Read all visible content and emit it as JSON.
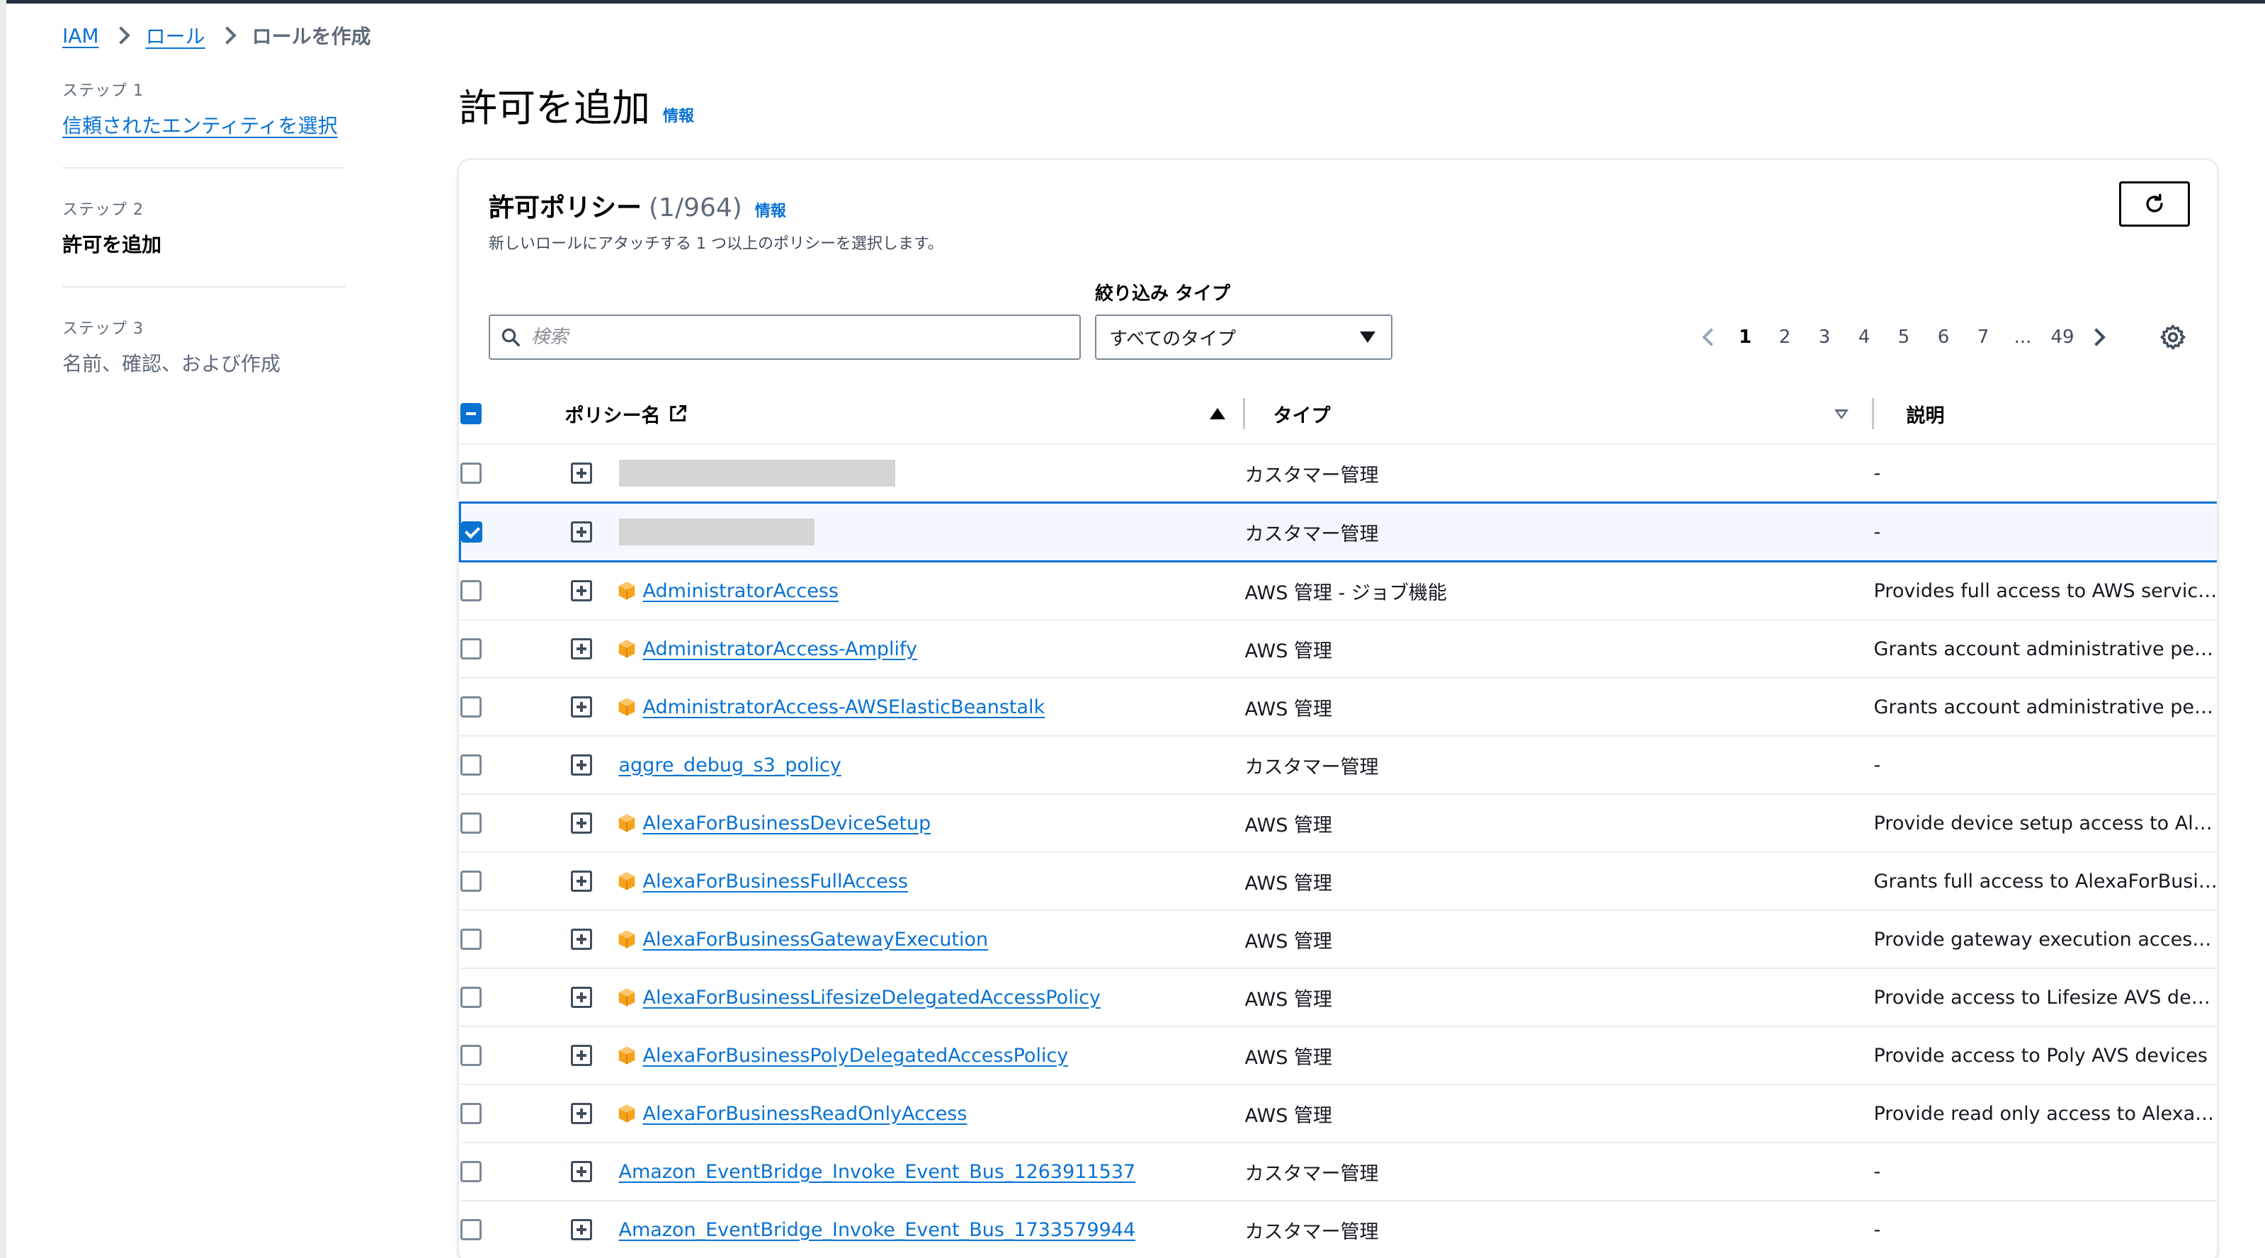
{
  "breadcrumb": {
    "iam": "IAM",
    "roles": "ロール",
    "current": "ロールを作成"
  },
  "steps": [
    {
      "label": "ステップ 1",
      "title": "信頼されたエンティティを選択"
    },
    {
      "label": "ステップ 2",
      "title": "許可を追加"
    },
    {
      "label": "ステップ 3",
      "title": "名前、確認、および作成"
    }
  ],
  "page_title": "許可を追加",
  "info": "情報",
  "panel": {
    "title": "許可ポリシー",
    "count": "(1/964)",
    "info": "情報",
    "subtitle": "新しいロールにアタッチする 1 つ以上のポリシーを選択します。"
  },
  "filter": {
    "search_placeholder": "検索",
    "type_label": "絞り込み タイプ",
    "type_value": "すべてのタイプ"
  },
  "pagination": {
    "pages": [
      "1",
      "2",
      "3",
      "4",
      "5",
      "6",
      "7",
      "...",
      "49"
    ],
    "current": "1"
  },
  "table": {
    "headers": {
      "name": "ポリシー名",
      "type": "タイプ",
      "desc": "説明"
    },
    "rows": [
      {
        "name": "",
        "type": "カスタマー管理",
        "desc": "-"
      },
      {
        "name": "",
        "type": "カスタマー管理",
        "desc": "-"
      },
      {
        "name": "AdministratorAccess",
        "type": "AWS 管理 - ジョブ機能",
        "desc": "Provides full access to AWS services an..."
      },
      {
        "name": "AdministratorAccess-Amplify",
        "type": "AWS 管理",
        "desc": "Grants account administrative permiss..."
      },
      {
        "name": "AdministratorAccess-AWSElasticBeanstalk",
        "type": "AWS 管理",
        "desc": "Grants account administrative permiss..."
      },
      {
        "name": "aggre_debug_s3_policy",
        "type": "カスタマー管理",
        "desc": "-"
      },
      {
        "name": "AlexaForBusinessDeviceSetup",
        "type": "AWS 管理",
        "desc": "Provide device setup access to AlexaFo..."
      },
      {
        "name": "AlexaForBusinessFullAccess",
        "type": "AWS 管理",
        "desc": "Grants full access to AlexaForBusiness ..."
      },
      {
        "name": "AlexaForBusinessGatewayExecution",
        "type": "AWS 管理",
        "desc": "Provide gateway execution access to A..."
      },
      {
        "name": "AlexaForBusinessLifesizeDelegatedAccessPolicy",
        "type": "AWS 管理",
        "desc": "Provide access to Lifesize AVS devices"
      },
      {
        "name": "AlexaForBusinessPolyDelegatedAccessPolicy",
        "type": "AWS 管理",
        "desc": "Provide access to Poly AVS devices"
      },
      {
        "name": "AlexaForBusinessReadOnlyAccess",
        "type": "AWS 管理",
        "desc": "Provide read only access to AlexaForB..."
      },
      {
        "name": "Amazon_EventBridge_Invoke_Event_Bus_1263911537",
        "type": "カスタマー管理",
        "desc": "-"
      },
      {
        "name": "Amazon_EventBridge_Invoke_Event_Bus_1733579944",
        "type": "カスタマー管理",
        "desc": "-"
      }
    ]
  },
  "icons": {
    "refresh": "refresh-icon",
    "search": "search-icon",
    "settings": "gear-icon",
    "external": "external-link-icon",
    "aws_managed": "aws-cube-icon"
  },
  "colors": {
    "link": "#0972d3",
    "aws_icon": "#f7a21b",
    "selected_row": "#f2f8fd",
    "header_bar": "#232f3e"
  }
}
